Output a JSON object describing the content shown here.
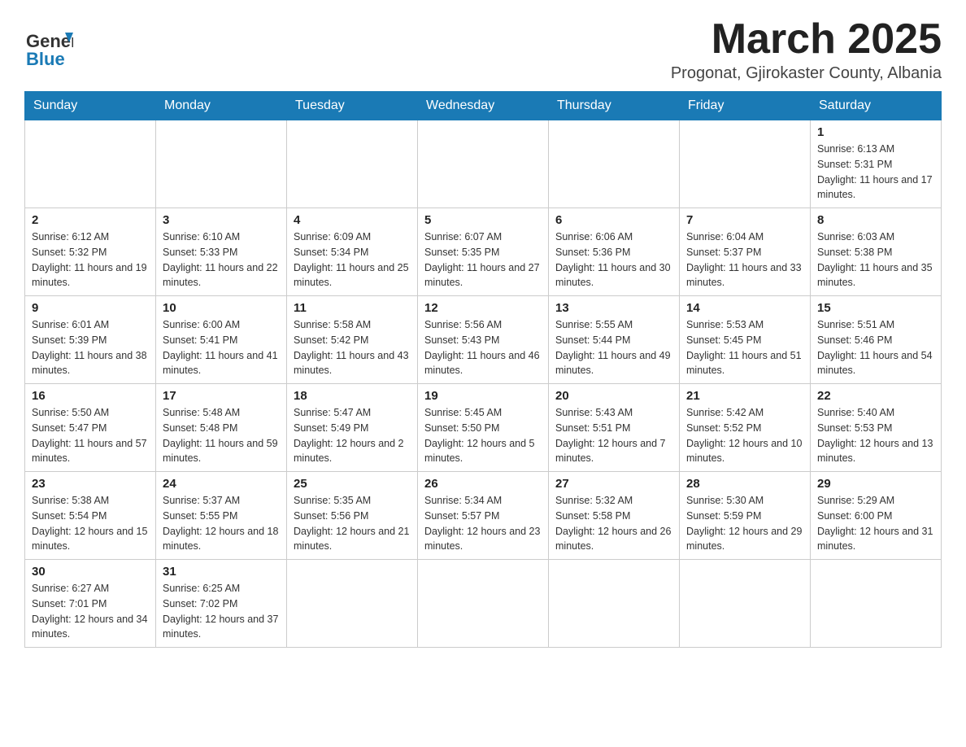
{
  "header": {
    "logo_line1": "General",
    "logo_line2": "Blue",
    "month": "March 2025",
    "location": "Progonat, Gjirokaster County, Albania"
  },
  "days_of_week": [
    "Sunday",
    "Monday",
    "Tuesday",
    "Wednesday",
    "Thursday",
    "Friday",
    "Saturday"
  ],
  "weeks": [
    [
      {
        "day": "",
        "info": ""
      },
      {
        "day": "",
        "info": ""
      },
      {
        "day": "",
        "info": ""
      },
      {
        "day": "",
        "info": ""
      },
      {
        "day": "",
        "info": ""
      },
      {
        "day": "",
        "info": ""
      },
      {
        "day": "1",
        "info": "Sunrise: 6:13 AM\nSunset: 5:31 PM\nDaylight: 11 hours and 17 minutes."
      }
    ],
    [
      {
        "day": "2",
        "info": "Sunrise: 6:12 AM\nSunset: 5:32 PM\nDaylight: 11 hours and 19 minutes."
      },
      {
        "day": "3",
        "info": "Sunrise: 6:10 AM\nSunset: 5:33 PM\nDaylight: 11 hours and 22 minutes."
      },
      {
        "day": "4",
        "info": "Sunrise: 6:09 AM\nSunset: 5:34 PM\nDaylight: 11 hours and 25 minutes."
      },
      {
        "day": "5",
        "info": "Sunrise: 6:07 AM\nSunset: 5:35 PM\nDaylight: 11 hours and 27 minutes."
      },
      {
        "day": "6",
        "info": "Sunrise: 6:06 AM\nSunset: 5:36 PM\nDaylight: 11 hours and 30 minutes."
      },
      {
        "day": "7",
        "info": "Sunrise: 6:04 AM\nSunset: 5:37 PM\nDaylight: 11 hours and 33 minutes."
      },
      {
        "day": "8",
        "info": "Sunrise: 6:03 AM\nSunset: 5:38 PM\nDaylight: 11 hours and 35 minutes."
      }
    ],
    [
      {
        "day": "9",
        "info": "Sunrise: 6:01 AM\nSunset: 5:39 PM\nDaylight: 11 hours and 38 minutes."
      },
      {
        "day": "10",
        "info": "Sunrise: 6:00 AM\nSunset: 5:41 PM\nDaylight: 11 hours and 41 minutes."
      },
      {
        "day": "11",
        "info": "Sunrise: 5:58 AM\nSunset: 5:42 PM\nDaylight: 11 hours and 43 minutes."
      },
      {
        "day": "12",
        "info": "Sunrise: 5:56 AM\nSunset: 5:43 PM\nDaylight: 11 hours and 46 minutes."
      },
      {
        "day": "13",
        "info": "Sunrise: 5:55 AM\nSunset: 5:44 PM\nDaylight: 11 hours and 49 minutes."
      },
      {
        "day": "14",
        "info": "Sunrise: 5:53 AM\nSunset: 5:45 PM\nDaylight: 11 hours and 51 minutes."
      },
      {
        "day": "15",
        "info": "Sunrise: 5:51 AM\nSunset: 5:46 PM\nDaylight: 11 hours and 54 minutes."
      }
    ],
    [
      {
        "day": "16",
        "info": "Sunrise: 5:50 AM\nSunset: 5:47 PM\nDaylight: 11 hours and 57 minutes."
      },
      {
        "day": "17",
        "info": "Sunrise: 5:48 AM\nSunset: 5:48 PM\nDaylight: 11 hours and 59 minutes."
      },
      {
        "day": "18",
        "info": "Sunrise: 5:47 AM\nSunset: 5:49 PM\nDaylight: 12 hours and 2 minutes."
      },
      {
        "day": "19",
        "info": "Sunrise: 5:45 AM\nSunset: 5:50 PM\nDaylight: 12 hours and 5 minutes."
      },
      {
        "day": "20",
        "info": "Sunrise: 5:43 AM\nSunset: 5:51 PM\nDaylight: 12 hours and 7 minutes."
      },
      {
        "day": "21",
        "info": "Sunrise: 5:42 AM\nSunset: 5:52 PM\nDaylight: 12 hours and 10 minutes."
      },
      {
        "day": "22",
        "info": "Sunrise: 5:40 AM\nSunset: 5:53 PM\nDaylight: 12 hours and 13 minutes."
      }
    ],
    [
      {
        "day": "23",
        "info": "Sunrise: 5:38 AM\nSunset: 5:54 PM\nDaylight: 12 hours and 15 minutes."
      },
      {
        "day": "24",
        "info": "Sunrise: 5:37 AM\nSunset: 5:55 PM\nDaylight: 12 hours and 18 minutes."
      },
      {
        "day": "25",
        "info": "Sunrise: 5:35 AM\nSunset: 5:56 PM\nDaylight: 12 hours and 21 minutes."
      },
      {
        "day": "26",
        "info": "Sunrise: 5:34 AM\nSunset: 5:57 PM\nDaylight: 12 hours and 23 minutes."
      },
      {
        "day": "27",
        "info": "Sunrise: 5:32 AM\nSunset: 5:58 PM\nDaylight: 12 hours and 26 minutes."
      },
      {
        "day": "28",
        "info": "Sunrise: 5:30 AM\nSunset: 5:59 PM\nDaylight: 12 hours and 29 minutes."
      },
      {
        "day": "29",
        "info": "Sunrise: 5:29 AM\nSunset: 6:00 PM\nDaylight: 12 hours and 31 minutes."
      }
    ],
    [
      {
        "day": "30",
        "info": "Sunrise: 6:27 AM\nSunset: 7:01 PM\nDaylight: 12 hours and 34 minutes."
      },
      {
        "day": "31",
        "info": "Sunrise: 6:25 AM\nSunset: 7:02 PM\nDaylight: 12 hours and 37 minutes."
      },
      {
        "day": "",
        "info": ""
      },
      {
        "day": "",
        "info": ""
      },
      {
        "day": "",
        "info": ""
      },
      {
        "day": "",
        "info": ""
      },
      {
        "day": "",
        "info": ""
      }
    ]
  ]
}
